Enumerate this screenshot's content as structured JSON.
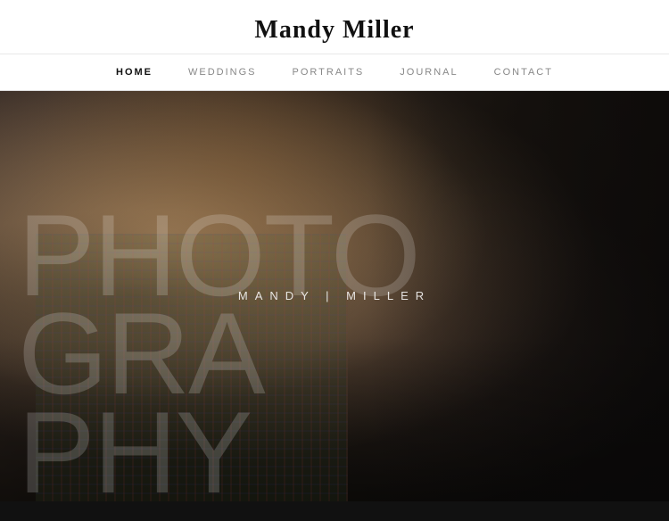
{
  "header": {
    "title": "Mandy Miller"
  },
  "nav": {
    "items": [
      {
        "label": "HOME",
        "active": true
      },
      {
        "label": "WEDDINGS",
        "active": false
      },
      {
        "label": "PORTRAITS",
        "active": false
      },
      {
        "label": "JOURNAL",
        "active": false
      },
      {
        "label": "CONTACT",
        "active": false
      }
    ]
  },
  "hero": {
    "overlay_name": "MANDY | MILLER",
    "big_text_line1": "PHOTO",
    "big_text_line2": "GRA",
    "big_text_suffix1": "T",
    "big_text_suffix2": "PHY"
  }
}
